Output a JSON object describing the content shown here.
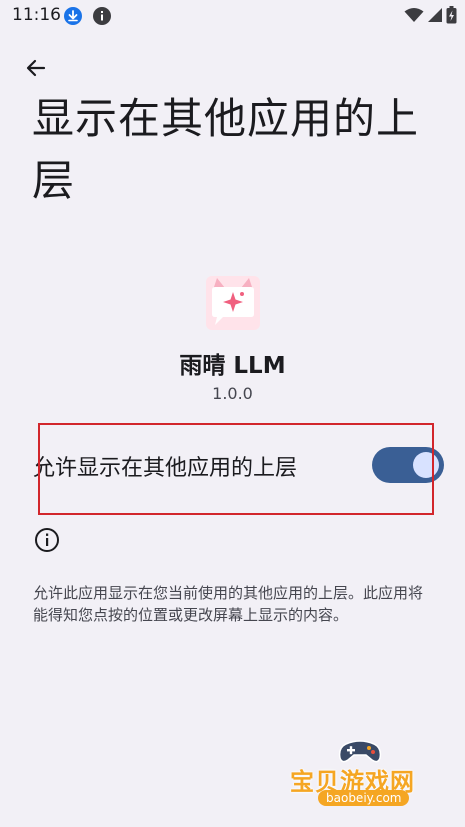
{
  "status_bar": {
    "time": "11:16",
    "icons": [
      "download-icon",
      "info-icon",
      "wifi-icon",
      "signal-icon",
      "battery-icon"
    ]
  },
  "header": {
    "back_icon": "arrow-left-icon",
    "title": "显示在其他应用的上层"
  },
  "app": {
    "icon": "app-logo",
    "name": "雨晴 LLM",
    "version": "1.0.0"
  },
  "toggle": {
    "label": "允许显示在其他应用的上层",
    "checked": true,
    "track_color": "#3a5f95",
    "thumb_color": "#d8e2ff"
  },
  "info": {
    "icon": "info-outline-icon",
    "text": "允许此应用显示在您当前使用的其他应用的上层。此应用将能得知您点按的位置或更改屏幕上显示的内容。"
  },
  "highlight": {
    "color": "#d2262c"
  },
  "watermark": {
    "title": "宝贝游戏网",
    "url": "baobeiy.com",
    "color": "#f5a623"
  }
}
